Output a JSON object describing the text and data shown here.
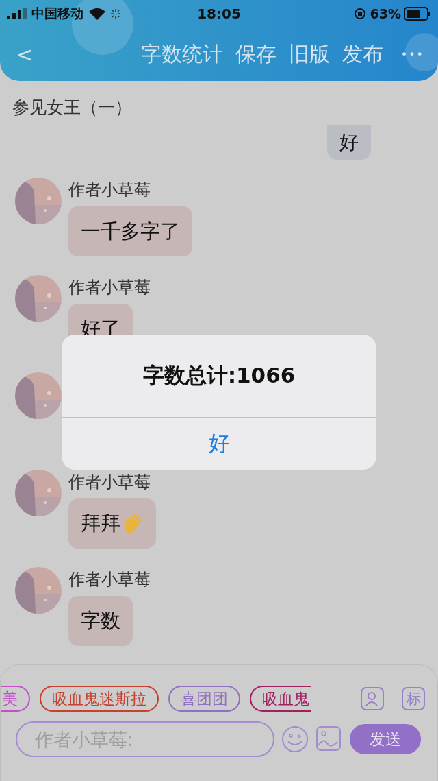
{
  "status_bar": {
    "carrier": "中国移动",
    "time": "18:05",
    "battery": "63%"
  },
  "nav_bar": {
    "back": "<",
    "actions": [
      "字数统计",
      "保存",
      "旧版",
      "发布"
    ],
    "more": "•••"
  },
  "chapter_title": "参见女王（一）",
  "own_message": {
    "text": "好"
  },
  "messages": [
    {
      "kind": "text",
      "name": "作者小草莓",
      "text": "一千多字了"
    },
    {
      "kind": "text",
      "name": "作者小草莓",
      "text": "好了"
    },
    {
      "kind": "covered"
    },
    {
      "kind": "text_with_hand",
      "name": "作者小草莓",
      "text": "拜拜"
    },
    {
      "kind": "text",
      "name": "作者小草莓",
      "text": "字数"
    }
  ],
  "tags": [
    {
      "kind": "cut_start",
      "label": "美",
      "color": "#c050c8"
    },
    {
      "kind": "full",
      "label": "吸血鬼迷斯拉",
      "color": "#c84030"
    },
    {
      "kind": "full",
      "label": "喜团团",
      "color": "#9070c0"
    },
    {
      "kind": "cut_end",
      "label": "吸血鬼",
      "color": "#a02060"
    }
  ],
  "mark_button": "标",
  "input": {
    "placeholder": "作者小草莓:"
  },
  "send_button": "发送",
  "alert": {
    "title": "字数总计:1066",
    "button": "好"
  }
}
